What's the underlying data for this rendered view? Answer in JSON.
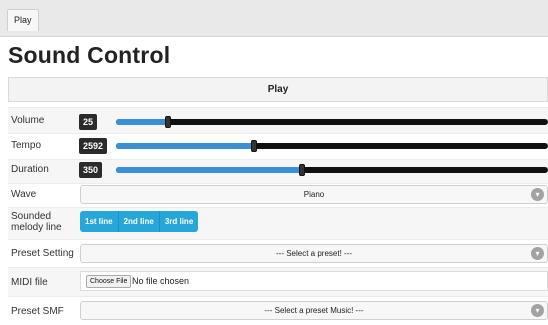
{
  "topbar": {
    "tab_label": "Play"
  },
  "page_title": "Sound Control",
  "play_bar_label": "Play",
  "volume": {
    "label": "Volume",
    "value": "25",
    "fraction": 0.12
  },
  "tempo": {
    "label": "Tempo",
    "value": "2592",
    "fraction": 0.32
  },
  "duration": {
    "label": "Duration",
    "value": "350",
    "fraction": 0.43
  },
  "wave": {
    "label": "Wave",
    "selected": "Piano",
    "icon": "chevron-down-icon"
  },
  "melody": {
    "label_line1": "Sounded",
    "label_line2": "melody line",
    "buttons": [
      "1st line",
      "2nd line",
      "3rd line"
    ]
  },
  "preset_setting": {
    "label": "Preset Setting",
    "selected": "--- Select a preset! ---"
  },
  "midi": {
    "label": "MIDI file",
    "button": "Choose File",
    "status": "No file chosen"
  },
  "preset_smf": {
    "label": "Preset SMF",
    "selected": "--- Select a preset Music! ---"
  },
  "colors": {
    "accent": "#3b8fd4",
    "button_blue": "#27a7d9",
    "track": "#111111"
  }
}
